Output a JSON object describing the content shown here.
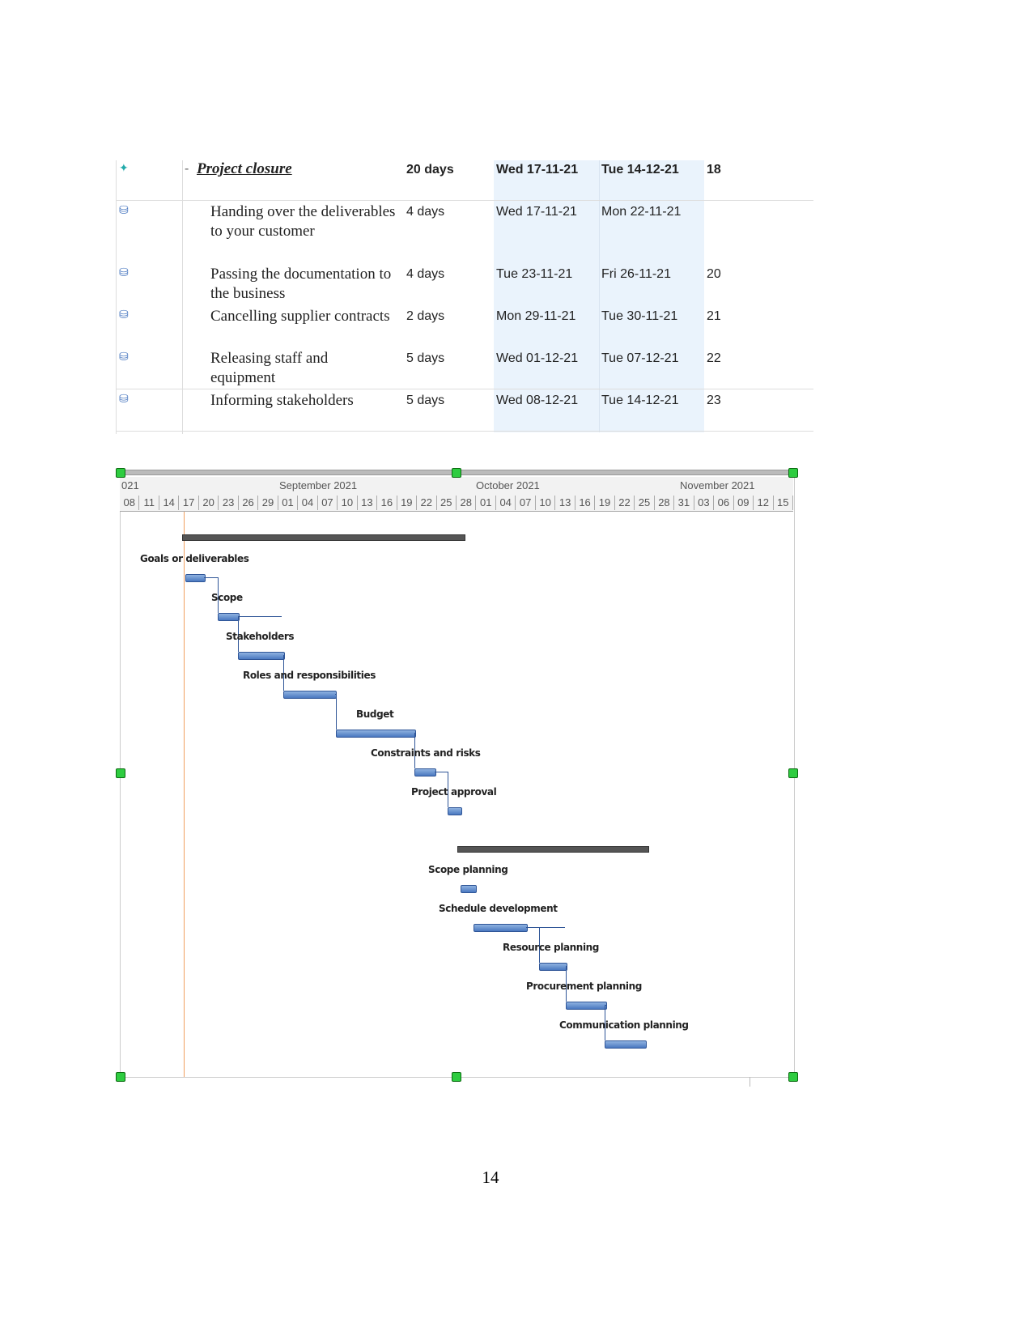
{
  "table": {
    "rows": [
      {
        "name": "Project closure",
        "duration": "20 days",
        "start": "Wed 17-11-21",
        "finish": "Tue 14-12-21",
        "pred": "18",
        "summary": true,
        "icon": "pin-icon"
      },
      {
        "name": "Handing over the deliverables to your customer",
        "duration": "4 days",
        "start": "Wed 17-11-21",
        "finish": "Mon 22-11-21",
        "pred": "",
        "icon": "task-icon"
      },
      {
        "name": "Passing the documentation to the business",
        "duration": "4 days",
        "start": "Tue 23-11-21",
        "finish": "Fri 26-11-21",
        "pred": "20",
        "icon": "task-icon"
      },
      {
        "name": "Cancelling supplier contracts",
        "duration": "2 days",
        "start": "Mon 29-11-21",
        "finish": "Tue 30-11-21",
        "pred": "21",
        "icon": "task-icon"
      },
      {
        "name": "Releasing staff and equipment",
        "duration": "5 days",
        "start": "Wed 01-12-21",
        "finish": "Tue 07-12-21",
        "pred": "22",
        "icon": "task-icon"
      },
      {
        "name": "Informing stakeholders",
        "duration": "5 days",
        "start": "Wed 08-12-21",
        "finish": "Tue 14-12-21",
        "pred": "23"
      }
    ],
    "collapse_symbol": "-"
  },
  "gantt": {
    "months": [
      "021",
      "September 2021",
      "October 2021",
      "November 2021"
    ],
    "days": [
      "08",
      "11",
      "14",
      "17",
      "20",
      "23",
      "26",
      "29",
      "01",
      "04",
      "07",
      "10",
      "13",
      "16",
      "19",
      "22",
      "25",
      "28",
      "01",
      "04",
      "07",
      "10",
      "13",
      "16",
      "19",
      "22",
      "25",
      "28",
      "31",
      "03",
      "06",
      "09",
      "12",
      "15"
    ],
    "tasks": [
      "Goals or deliverables",
      "Scope",
      "Stakeholders",
      "Roles and responsibilities",
      "Budget",
      "Constraints and risks",
      "Project approval",
      "Scope planning",
      "Schedule development",
      "Resource planning",
      "Procurement planning",
      "Communication planning"
    ],
    "bar_color": "#4a78c0",
    "today_line_color": "#f0a060"
  },
  "footer": {
    "page_number": "14"
  }
}
